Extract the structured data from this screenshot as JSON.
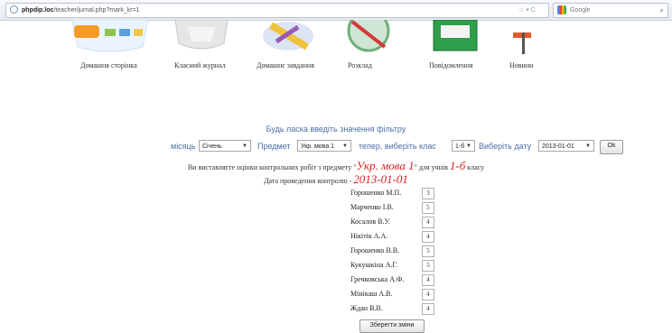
{
  "browser": {
    "url_host": "phpdip.loc",
    "url_path": "/teacher/jurnal.php?mark_kr=1",
    "search_engine": "Google"
  },
  "nav": {
    "items": [
      {
        "label": "Домашня сторінка"
      },
      {
        "label": "Класний журнал"
      },
      {
        "label": "Домашнє завдання"
      },
      {
        "label": "Розклад"
      },
      {
        "label": "Повідомлення"
      },
      {
        "label": "Новини"
      }
    ]
  },
  "filter": {
    "prompt": "Будь ласка введіть значення фільтру",
    "month_label": "місяць",
    "month_value": "Січень",
    "subject_label": "Предмет",
    "subject_value": "Укр. мова 1",
    "class_label": "тепер, виберіть клас",
    "class_value": "1-б",
    "date_label": "Виберіть дату",
    "date_value": "2013-01-01",
    "ok_label": "Ok"
  },
  "info": {
    "line1_prefix": "Ви виставляєте оцінки контрольних робіт з предмету \"",
    "subject": "Укр. мова 1",
    "line1_middle": "\" для учнів",
    "class": "1-б",
    "line1_suffix": "класу",
    "line2_prefix": "Дата проведення контролю -",
    "date": "2013-01-01"
  },
  "students": [
    {
      "name": "Горошенко М.П.",
      "mark": "3"
    },
    {
      "name": "Марченко І.В.",
      "mark": "5"
    },
    {
      "name": "Косалов В.У.",
      "mark": "4"
    },
    {
      "name": "Нікітік А.А.",
      "mark": "4"
    },
    {
      "name": "Горошенко В.В.",
      "mark": "5"
    },
    {
      "name": "Кукушкіна А.Г.",
      "mark": "5"
    },
    {
      "name": "Гречковська А.Ф.",
      "mark": "4"
    },
    {
      "name": "Мінікаш А.В.",
      "mark": "4"
    },
    {
      "name": "Ждан В.В.",
      "mark": "4"
    }
  ],
  "save_label": "Зберегти зміни"
}
